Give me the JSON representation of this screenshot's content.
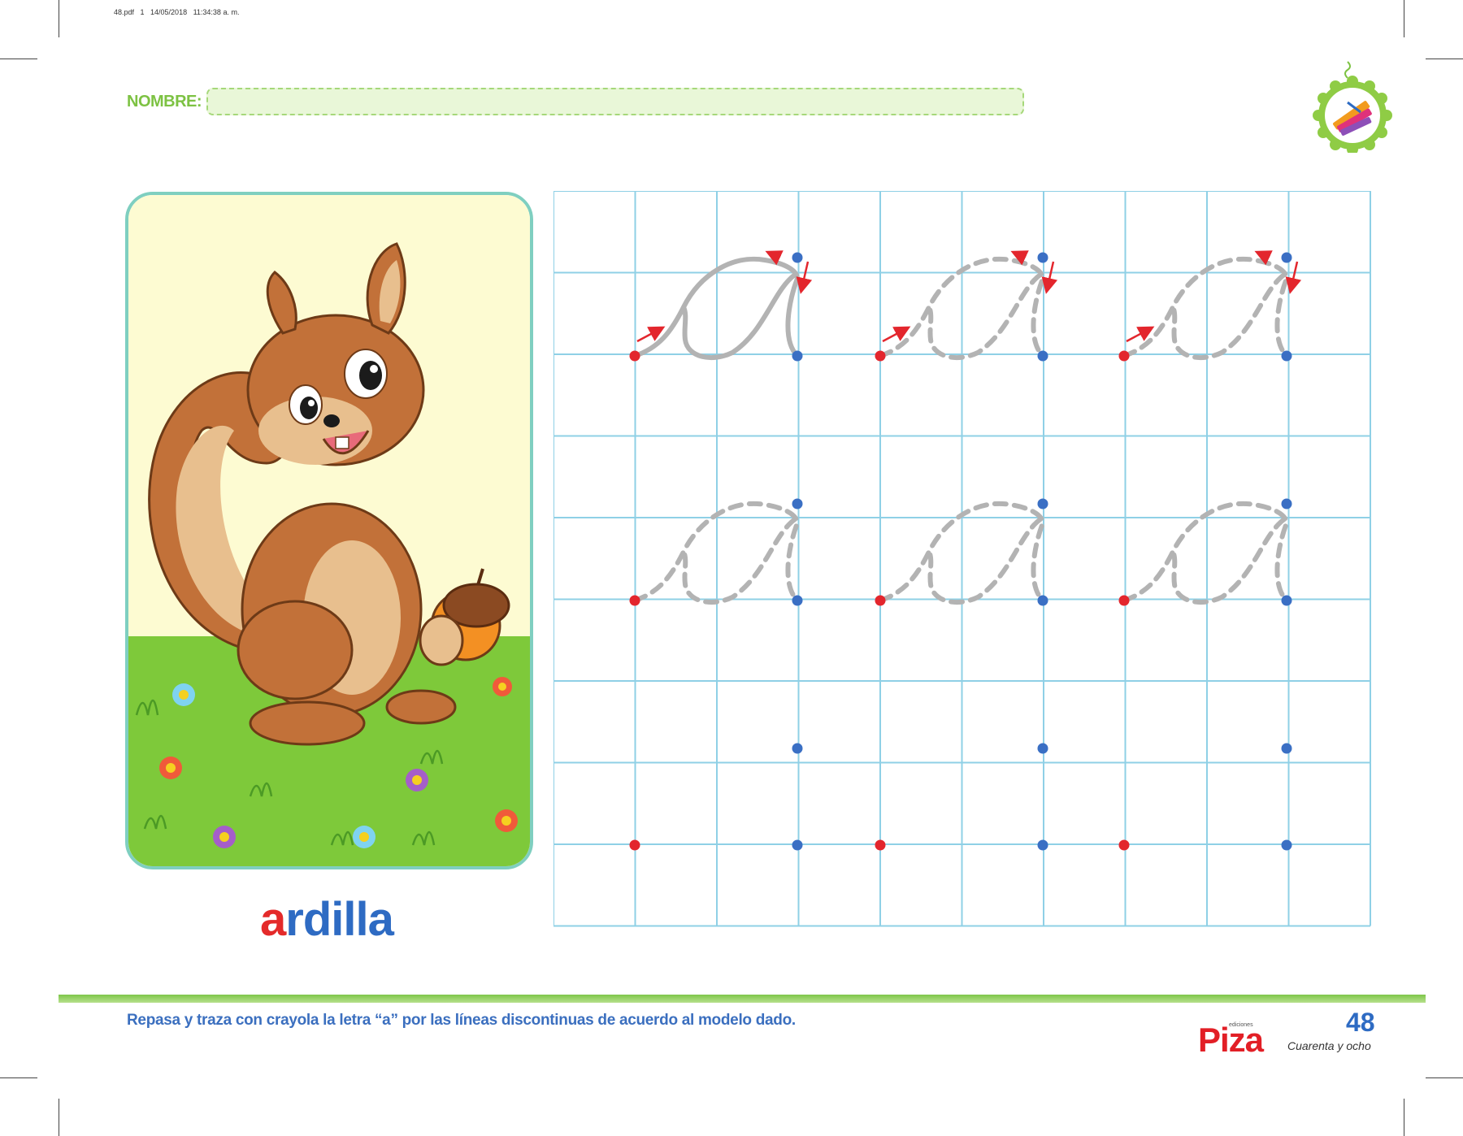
{
  "print_info": "48.pdf   1   14/05/2018   11:34:38 a. m.",
  "header": {
    "name_label": "NOMBRE:",
    "badge_icon": "crayon-icon"
  },
  "card": {
    "illustration": "squirrel-with-acorn",
    "word_first_letter": "a",
    "word_rest": "rdilla"
  },
  "worksheet": {
    "letter": "a",
    "start_dot_color": "#e3262d",
    "end_dot_color": "#3a6fc4",
    "grid_color": "#8fd0e6"
  },
  "footer": {
    "instruction": "Repasa y traza con crayola la letra “a” por las líneas discontinuas de acuerdo al modelo dado.",
    "brand_small": "ediciones",
    "brand": "Piza",
    "page_number": "48",
    "page_number_words": "Cuarenta y ocho"
  }
}
